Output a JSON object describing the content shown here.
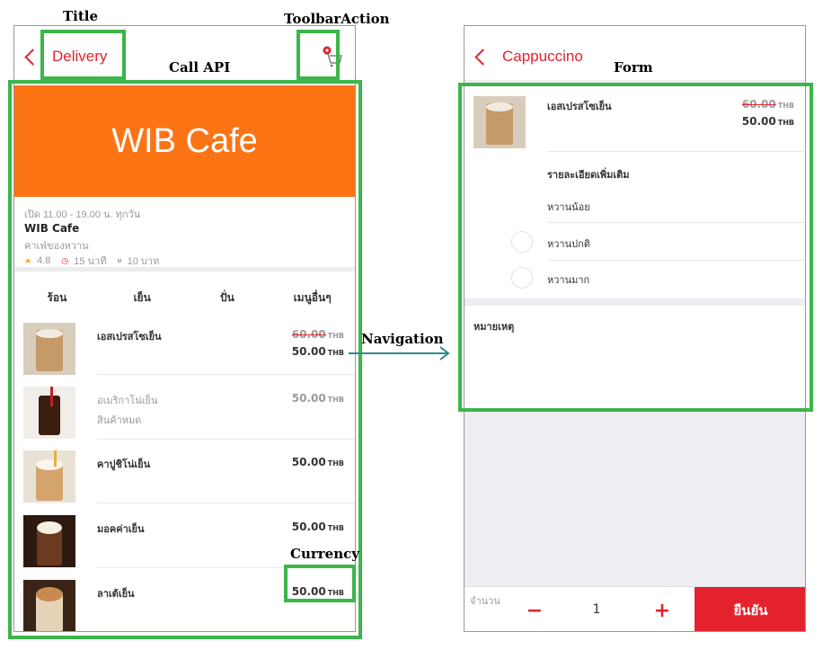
{
  "annotations": {
    "title": "Title",
    "toolbar_action": "ToolbarAction",
    "call_api": "Call API",
    "form": "Form",
    "navigation": "Navigation",
    "currency": "Currency"
  },
  "left_screen": {
    "nav_title": "Delivery",
    "banner_title": "WIB Cafe",
    "hours": "เปิด 11.00 - 19.00 น. ทุกวัน",
    "shop_name": "WIB Cafe",
    "shop_desc": "คาเฟ่ของหวาน",
    "rating": "4.8",
    "time": "15 นาที",
    "fee": "10 บาท",
    "tabs": [
      "ร้อน",
      "เย็น",
      "ปั่น",
      "เมนูอื่นๆ"
    ],
    "items": [
      {
        "name": "เอสเปรสโซเย็น",
        "old_price": "60.00",
        "price": "50.00",
        "currency": "THB",
        "sub": ""
      },
      {
        "name": "อเมริกาโน่เย็น",
        "old_price": "",
        "price": "50.00",
        "currency": "THB",
        "sub": "สินค้าหมด"
      },
      {
        "name": "คาปูชิโน่เย็น",
        "old_price": "",
        "price": "50.00",
        "currency": "THB",
        "sub": ""
      },
      {
        "name": "มอคค่าเย็น",
        "old_price": "",
        "price": "50.00",
        "currency": "THB",
        "sub": ""
      },
      {
        "name": "ลาเต้เย็น",
        "old_price": "",
        "price": "50.00",
        "currency": "THB",
        "sub": ""
      }
    ]
  },
  "right_screen": {
    "nav_title": "Cappuccino",
    "item_name": "เอสเปรสโซเย็น",
    "old_price": "60.00",
    "price": "50.00",
    "currency": "THB",
    "details_title": "รายละเอียดเพิ่มเติม",
    "options": [
      "หวานน้อย",
      "หวานปกติ",
      "หวานมาก"
    ],
    "note_label": "หมายเหตุ",
    "quantity_label": "จำนวน",
    "minus": "−",
    "quantity": "1",
    "plus": "+",
    "confirm": "ยืนยัน"
  },
  "colors": {
    "accent_red": "#e4222e",
    "banner_orange": "#fd7415",
    "annotation_green": "#3cb54a"
  }
}
